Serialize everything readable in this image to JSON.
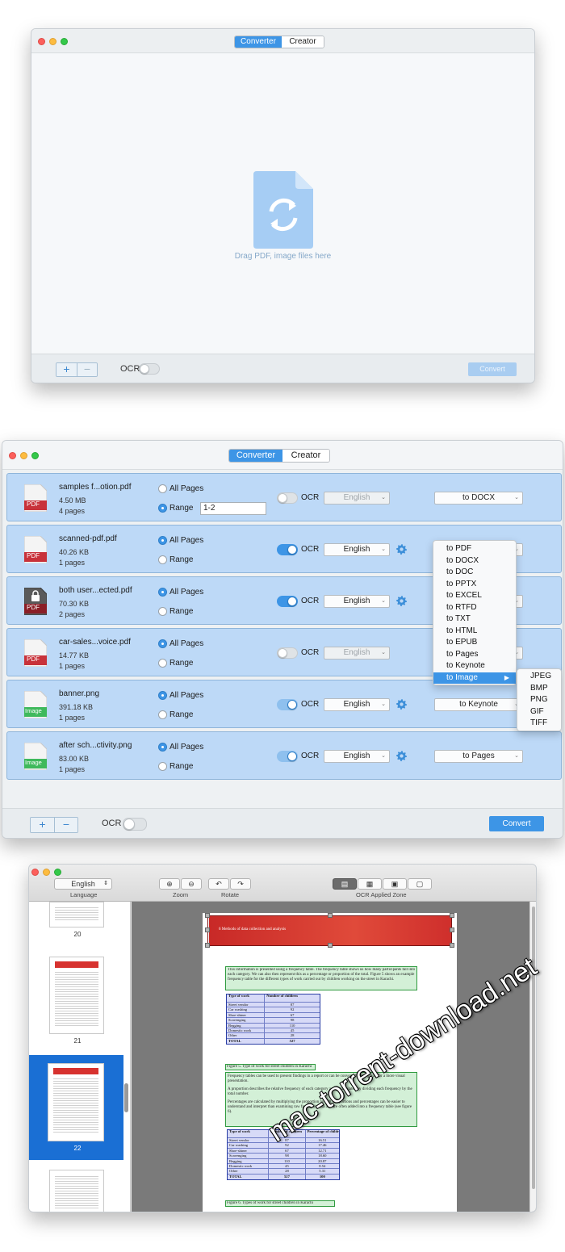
{
  "tabs": {
    "converter": "Converter",
    "creator": "Creator"
  },
  "window1": {
    "drop_text": "Drag PDF, image files here",
    "add_label": "+",
    "remove_label": "−",
    "ocr_label": "OCR",
    "convert_label": "Convert",
    "ocr_enabled": false
  },
  "window2": {
    "option_all_pages": "All Pages",
    "option_range": "Range",
    "ocr_label": "OCR",
    "files": [
      {
        "name": "samples f...otion.pdf",
        "size": "4.50 MB",
        "pages": "4 pages",
        "type_label": "PDF",
        "page_mode": "range",
        "range_value": "1-2",
        "ocr": false,
        "language": "English",
        "format": "to DOCX"
      },
      {
        "name": "scanned-pdf.pdf",
        "size": "40.26 KB",
        "pages": "1 pages",
        "type_label": "PDF",
        "page_mode": "all",
        "ocr": true,
        "language": "English",
        "format": ""
      },
      {
        "name": "both user...ected.pdf",
        "size": "70.30 KB",
        "pages": "2 pages",
        "type_label": "PDF",
        "locked": true,
        "page_mode": "all",
        "ocr": true,
        "language": "English",
        "format": ""
      },
      {
        "name": "car-sales...voice.pdf",
        "size": "14.77 KB",
        "pages": "1 pages",
        "type_label": "PDF",
        "page_mode": "all",
        "ocr": false,
        "language": "English",
        "format": ""
      },
      {
        "name": "banner.png",
        "size": "391.18 KB",
        "pages": "1 pages",
        "type_label": "Image",
        "page_mode": "all",
        "ocr": true,
        "language": "English",
        "format": "to Keynote"
      },
      {
        "name": "after sch...ctivity.png",
        "size": "83.00 KB",
        "pages": "1 pages",
        "type_label": "Image",
        "page_mode": "all",
        "ocr": true,
        "language": "English",
        "format": "to Pages"
      }
    ],
    "format_menu": [
      "to PDF",
      "to DOCX",
      "to DOC",
      "to PPTX",
      "to EXCEL",
      "to RTFD",
      "to TXT",
      "to HTML",
      "to EPUB",
      "to Pages",
      "to Keynote",
      "to Image"
    ],
    "highlighted_format": "to Image",
    "image_submenu": [
      "JPEG",
      "BMP",
      "PNG",
      "GIF",
      "TIFF"
    ],
    "add_label": "+",
    "remove_label": "−",
    "convert_label": "Convert",
    "ocr_enabled": false
  },
  "window3": {
    "language_value": "English",
    "language_label": "Language",
    "zoom_label": "Zoom",
    "rotate_label": "Rotate",
    "zone_label": "OCR Applied Zone",
    "thumb_numbers": [
      "20",
      "21",
      "22"
    ],
    "selected_thumb": "22",
    "header_text": "6 Methods of data collection and analysis",
    "para1": "This information is presented using a frequency table. The frequency table shows us how many participants fall into each category. We can also then represent this as a percentage or proportion of the total. Figure 5 shows an example frequency table for the different types of work carried out by children working on the street in Karachi.",
    "table1": {
      "headers": [
        "Type of work",
        "Number of children"
      ],
      "rows": [
        [
          "Street vendor",
          "87"
        ],
        [
          "Car washing",
          "92"
        ],
        [
          "Shoe-shiner",
          "67"
        ],
        [
          "Scavenging",
          "98"
        ],
        [
          "Begging",
          "110"
        ],
        [
          "Domestic work",
          "45"
        ],
        [
          "Other",
          "28"
        ],
        [
          "TOTAL",
          "527"
        ]
      ]
    },
    "caption1": "Figure 5. Type of work for street children in Karachi",
    "para2": "Frequency tables can be used to present findings in a report or can be converted into a graph for a more visual presentation.",
    "para3": "A proportion describes the relative frequency of each category and is calculated by dividing each frequency by the total number.",
    "para4": "Percentages are calculated by multiplying the proportion by 100. Proportions and percentages can be easier to understand and interpret than examining raw frequency data and are often added into a frequency table (see figure 6).",
    "table2": {
      "headers": [
        "Type of work",
        "Number of children",
        "Percentage of children"
      ],
      "rows": [
        [
          "Street vendor",
          "87",
          "16.51"
        ],
        [
          "Car washing",
          "92",
          "17.46"
        ],
        [
          "Shoe-shiner",
          "67",
          "12.71"
        ],
        [
          "Scavenging",
          "98",
          "18.60"
        ],
        [
          "Begging",
          "110",
          "20.87"
        ],
        [
          "Domestic work",
          "45",
          "8.54"
        ],
        [
          "Other",
          "28",
          "5.31"
        ],
        [
          "TOTAL",
          "527",
          "100"
        ]
      ]
    },
    "caption2": "Figure 6. Types of work for street children in Karachi"
  },
  "watermark": "mac-torrent-download.net",
  "colors": {
    "accent": "#3d95e6",
    "row_bg": "#bdd9f7",
    "pdf_red": "#c8323a",
    "image_green": "#3fb95c",
    "zone_green": "#2f9a3f",
    "table_blue": "#2b3fa5",
    "header_red": "#d7322f"
  }
}
